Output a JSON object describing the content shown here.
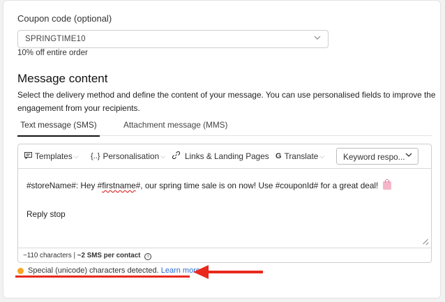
{
  "coupon": {
    "label": "Coupon code (optional)",
    "value": "SPRINGTIME10",
    "description": "10% off entire order"
  },
  "message": {
    "title": "Message content",
    "subtitle": "Select the delivery method and define the content of your message. You can use personalised fields to improve the engagement from your recipients."
  },
  "tabs": [
    {
      "label": "Text message (SMS)",
      "active": true
    },
    {
      "label": "Attachment message (MMS)",
      "active": false
    }
  ],
  "toolbar": {
    "templates": "Templates",
    "personalisation": "Personalisation",
    "personalisation_icon": "{..}",
    "links": "Links & Landing Pages",
    "translate": "Translate",
    "translate_icon": "G",
    "keyword": "Keyword respo..."
  },
  "editor": {
    "line1_a": "#storeName#: Hey #",
    "line1_b": "firstname",
    "line1_c": "#, our spring time sale is on now! Use #couponId# for a great deal!",
    "line2": "Reply stop"
  },
  "footer": {
    "chars": "~110 characters | ",
    "sms": "~2 SMS per contact"
  },
  "warning": {
    "text": "Special (unicode) characters detected.",
    "link": "Learn more."
  },
  "annotation": {
    "color": "#e8291c"
  }
}
